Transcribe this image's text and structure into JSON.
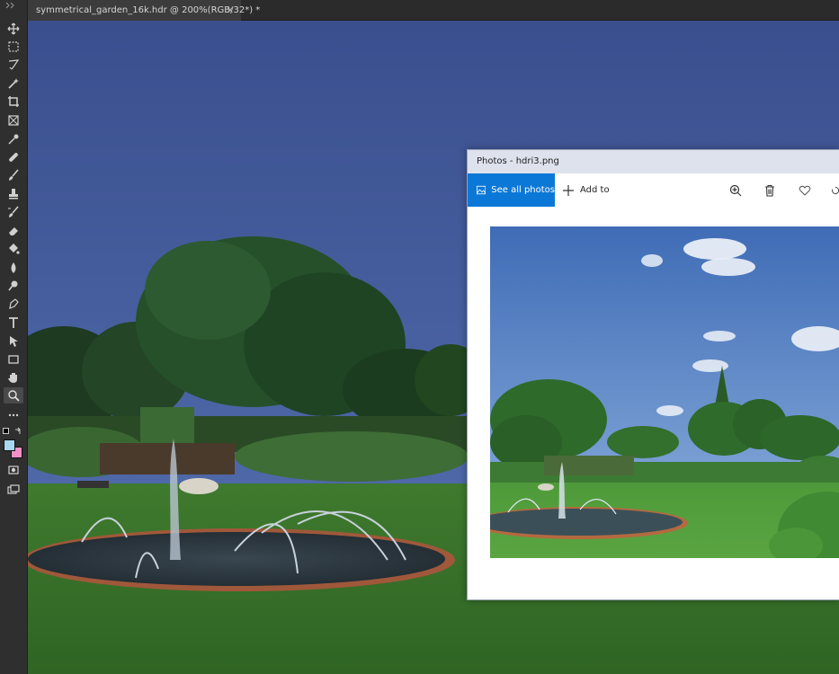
{
  "photoshop": {
    "document_tab": "symmetrical_garden_16k.hdr @ 200%(RGB/32*) *",
    "tab_close": "×",
    "foreground_color": "#a8d8f0",
    "background_color": "#f08fc8"
  },
  "photos_app": {
    "title": "Photos - hdri3.png",
    "see_all_label": "See all photos",
    "add_to_label": "Add to",
    "accent_color": "#0b78d7"
  },
  "icons": {
    "tools": [
      "move-icon",
      "marquee-icon",
      "lasso-icon",
      "magic-wand-icon",
      "crop-icon",
      "frame-icon",
      "eyedropper-icon",
      "healing-icon",
      "brush-icon",
      "stamp-icon",
      "history-brush-icon",
      "eraser-icon",
      "paint-bucket-icon",
      "blur-icon",
      "dodge-icon",
      "pen-icon",
      "type-icon",
      "path-select-icon",
      "rectangle-icon",
      "hand-icon",
      "zoom-icon",
      "more-tools-icon"
    ],
    "photos_commands": [
      "zoom-in-icon",
      "delete-icon",
      "favorite-icon",
      "rotate-icon"
    ]
  }
}
